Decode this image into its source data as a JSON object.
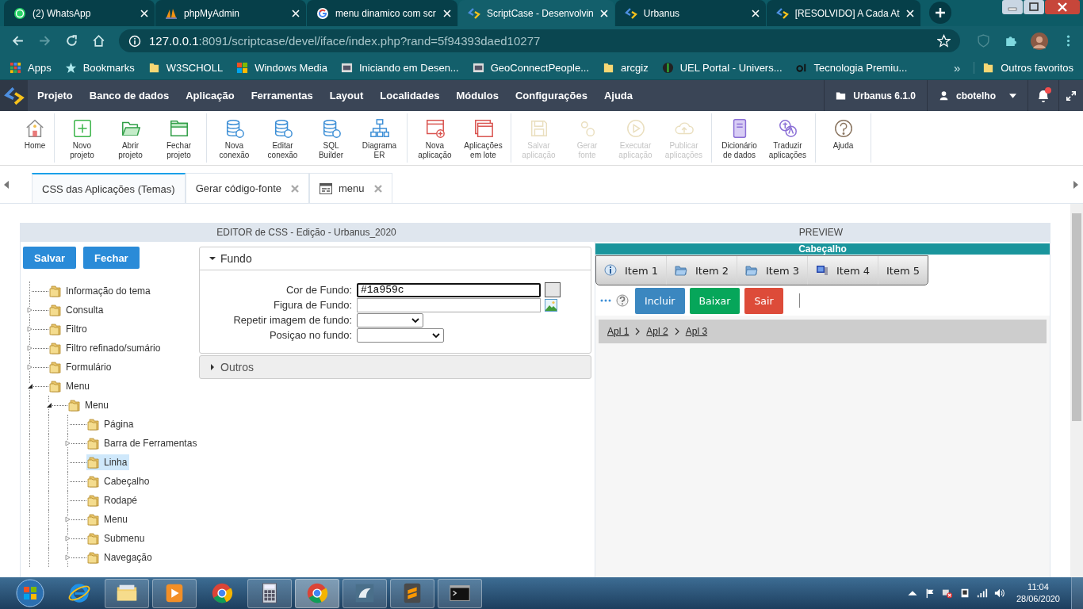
{
  "browser": {
    "tabs": [
      {
        "title": "(2) WhatsApp",
        "kind": "whatsapp",
        "selected": false
      },
      {
        "title": "phpMyAdmin",
        "kind": "sails",
        "selected": false
      },
      {
        "title": "menu dinamico com scr",
        "kind": "google",
        "selected": false
      },
      {
        "title": "ScriptCase - Desenvolvin",
        "kind": "scriptcase",
        "selected": true
      },
      {
        "title": "Urbanus",
        "kind": "scriptcase",
        "selected": false
      },
      {
        "title": "[RESOLVIDO] A Cada At",
        "kind": "scriptcase",
        "selected": false
      }
    ],
    "address": {
      "host": "127.0.0.1",
      "path": ":8091/scriptcase/devel/iface/index.php?rand=5f94393daed10277"
    },
    "bookmarks": [
      {
        "label": "Apps",
        "kind": "apps"
      },
      {
        "label": "Bookmarks",
        "kind": "star"
      },
      {
        "label": "W3SCHOLL",
        "kind": "folder"
      },
      {
        "label": "Windows Media",
        "kind": "windows"
      },
      {
        "label": "Iniciando em Desen...",
        "kind": "thumb"
      },
      {
        "label": "GeoConnectPeople...",
        "kind": "thumb"
      },
      {
        "label": "arcgiz",
        "kind": "folder"
      },
      {
        "label": "UEL Portal - Univers...",
        "kind": "globe"
      },
      {
        "label": "Tecnologia Premiu...",
        "kind": "mark"
      }
    ],
    "more_bookmarks": "»",
    "other_bookmarks": "Outros favoritos"
  },
  "app": {
    "menu": [
      "Projeto",
      "Banco de dados",
      "Aplicação",
      "Ferramentas",
      "Layout",
      "Localidades",
      "Módulos",
      "Configurações",
      "Ajuda"
    ],
    "project": "Urbanus 6.1.0",
    "user": "cbotelho"
  },
  "toolbar": {
    "groups": [
      [
        {
          "label": "Home",
          "kind": "home",
          "disabled": false
        }
      ],
      [
        {
          "label": "Novo\nprojeto",
          "kind": "new-project",
          "disabled": false
        },
        {
          "label": "Abrir\nprojeto",
          "kind": "open-folder",
          "disabled": false
        },
        {
          "label": "Fechar\nprojeto",
          "kind": "folder",
          "disabled": false
        }
      ],
      [
        {
          "label": "Nova\nconexão",
          "kind": "db-add",
          "disabled": false
        },
        {
          "label": "Editar\nconexão",
          "kind": "db-edit",
          "disabled": false
        },
        {
          "label": "SQL\nBuilder",
          "kind": "db-star",
          "disabled": false
        },
        {
          "label": "Diagrama\nER",
          "kind": "diagram",
          "disabled": false
        }
      ],
      [
        {
          "label": "Nova\naplicação",
          "kind": "app-add",
          "disabled": false
        },
        {
          "label": "Aplicações\nem lote",
          "kind": "apps",
          "disabled": false
        }
      ],
      [
        {
          "label": "Salvar\naplicação",
          "kind": "save",
          "disabled": true
        },
        {
          "label": "Gerar\nfonte",
          "kind": "gears",
          "disabled": true
        },
        {
          "label": "Executar\naplicação",
          "kind": "play",
          "disabled": true
        },
        {
          "label": "Publicar\naplicações",
          "kind": "cloud",
          "disabled": true
        }
      ],
      [
        {
          "label": "Dicionário\nde dados",
          "kind": "book",
          "disabled": false
        },
        {
          "label": "Traduzir\naplicações",
          "kind": "translate",
          "disabled": false
        }
      ],
      [
        {
          "label": "Ajuda",
          "kind": "help",
          "disabled": false
        }
      ]
    ]
  },
  "doc_tabs": [
    {
      "label": "CSS das Aplicações (Temas)",
      "selected": true,
      "closable": false,
      "kind": "plain"
    },
    {
      "label": "Gerar código-fonte",
      "selected": false,
      "closable": true,
      "kind": "plain"
    },
    {
      "label": "menu",
      "selected": false,
      "closable": true,
      "kind": "form"
    }
  ],
  "editor": {
    "title": "EDITOR de CSS - Edição - Urbanus_2020",
    "buttons": [
      "Salvar",
      "Fechar"
    ],
    "tree": [
      {
        "label": "Informação do tema",
        "kind": "leaf",
        "selected": false
      },
      {
        "label": "Consulta",
        "kind": "branch",
        "expanded": false,
        "selected": false
      },
      {
        "label": "Filtro",
        "kind": "branch",
        "expanded": false,
        "selected": false
      },
      {
        "label": "Filtro refinado/sumário",
        "kind": "branch",
        "expanded": false,
        "selected": false
      },
      {
        "label": "Formulário",
        "kind": "branch",
        "expanded": false,
        "selected": false
      },
      {
        "label": "Menu",
        "kind": "branch",
        "expanded": true,
        "selected": false,
        "children": [
          {
            "label": "Menu",
            "kind": "branch",
            "expanded": true,
            "selected": false,
            "children": [
              {
                "label": "Página",
                "kind": "leaf",
                "selected": false
              },
              {
                "label": "Barra de Ferramentas",
                "kind": "branch",
                "expanded": false,
                "selected": false
              },
              {
                "label": "Linha",
                "kind": "leaf",
                "selected": true
              },
              {
                "label": "Cabeçalho",
                "kind": "leaf",
                "selected": false
              },
              {
                "label": "Rodapé",
                "kind": "leaf",
                "selected": false
              },
              {
                "label": "Menu",
                "kind": "branch",
                "expanded": false,
                "selected": false
              },
              {
                "label": "Submenu",
                "kind": "branch",
                "expanded": false,
                "selected": false
              },
              {
                "label": "Navegação",
                "kind": "branch",
                "expanded": false,
                "selected": false
              }
            ]
          }
        ]
      }
    ],
    "sections": [
      {
        "title": "Fundo",
        "expanded": true,
        "fields": [
          {
            "label": "Cor de Fundo:",
            "kind": "color",
            "value": "#1a959c",
            "focused": true
          },
          {
            "label": "Figura de Fundo:",
            "kind": "image",
            "focused": false
          },
          {
            "label": "Repetir imagem de fundo:",
            "kind": "select",
            "focused": false
          },
          {
            "label": "Posiçao no fundo:",
            "kind": "select-wide",
            "focused": false
          }
        ]
      },
      {
        "title": "Outros",
        "expanded": false
      }
    ]
  },
  "preview": {
    "title": "PREVIEW",
    "header": "Cabeçalho",
    "menu": [
      {
        "label": "Item 1",
        "kind": "info"
      },
      {
        "label": "Item 2",
        "kind": "folder"
      },
      {
        "label": "Item 3",
        "kind": "folder"
      },
      {
        "label": "Item 4",
        "kind": "computer"
      },
      {
        "label": "Item 5",
        "kind": "plain"
      }
    ],
    "buttons": [
      {
        "label": "Incluir",
        "color": "#3b87c0"
      },
      {
        "label": "Baixar",
        "color": "#06a65a"
      },
      {
        "label": "Sair",
        "color": "#dd4b39"
      }
    ],
    "breadcrumbs": [
      "Apl 1",
      "Apl 2",
      "Apl 3"
    ]
  },
  "taskbar": {
    "apps": [
      {
        "kind": "ie",
        "running": false,
        "selected": false
      },
      {
        "kind": "explorer",
        "running": true,
        "selected": false
      },
      {
        "kind": "media",
        "running": true,
        "selected": false
      },
      {
        "kind": "chrome",
        "running": false,
        "selected": false
      },
      {
        "kind": "calculator",
        "running": true,
        "selected": false
      },
      {
        "kind": "chrome",
        "running": true,
        "selected": true
      },
      {
        "kind": "dolphin",
        "running": true,
        "selected": false
      },
      {
        "kind": "sublime",
        "running": true,
        "selected": false
      },
      {
        "kind": "terminal",
        "running": true,
        "selected": false
      }
    ],
    "time": "11:04",
    "date": "28/06/2020"
  }
}
